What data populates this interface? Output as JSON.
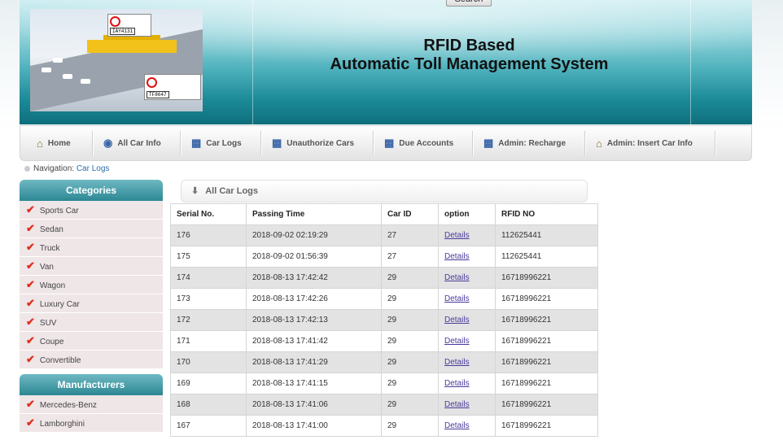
{
  "search": {
    "label": "Search"
  },
  "header": {
    "title_line1": "RFID Based",
    "title_line2": "Automatic Toll Management System"
  },
  "banner": {
    "plate_top": "IAY4131",
    "plate_bottom": "TF8647"
  },
  "nav": [
    {
      "label": "Home",
      "icon": "home-icon"
    },
    {
      "label": "All Car Info",
      "icon": "globe-icon"
    },
    {
      "label": "Car Logs",
      "icon": "car-icon"
    },
    {
      "label": "Unauthorize Cars",
      "icon": "car-icon"
    },
    {
      "label": "Due Accounts",
      "icon": "car-icon"
    },
    {
      "label": "Admin: Recharge",
      "icon": "car-icon"
    },
    {
      "label": "Admin: Insert Car Info",
      "icon": "home-icon"
    }
  ],
  "breadcrumb": {
    "prefix": "Navigation:",
    "link": "Car Logs"
  },
  "categories": {
    "title": "Categories",
    "items": [
      "Sports Car",
      "Sedan",
      "Truck",
      "Van",
      "Wagon",
      "Luxury Car",
      "SUV",
      "Coupe",
      "Convertible"
    ]
  },
  "manufacturers": {
    "title": "Manufacturers",
    "items": [
      "Mercedes-Benz",
      "Lamborghini"
    ]
  },
  "panel": {
    "title": "All Car Logs"
  },
  "table": {
    "headers": [
      "Serial No.",
      "Passing Time",
      "Car ID",
      "option",
      "RFID NO"
    ],
    "rows": [
      [
        "176",
        "2018-09-02 02:19:29",
        "27",
        "Details",
        "112625441"
      ],
      [
        "175",
        "2018-09-02 01:56:39",
        "27",
        "Details",
        "112625441"
      ],
      [
        "174",
        "2018-08-13 17:42:42",
        "29",
        "Details",
        "16718996221"
      ],
      [
        "173",
        "2018-08-13 17:42:26",
        "29",
        "Details",
        "16718996221"
      ],
      [
        "172",
        "2018-08-13 17:42:13",
        "29",
        "Details",
        "16718996221"
      ],
      [
        "171",
        "2018-08-13 17:41:42",
        "29",
        "Details",
        "16718996221"
      ],
      [
        "170",
        "2018-08-13 17:41:29",
        "29",
        "Details",
        "16718996221"
      ],
      [
        "169",
        "2018-08-13 17:41:15",
        "29",
        "Details",
        "16718996221"
      ],
      [
        "168",
        "2018-08-13 17:41:06",
        "29",
        "Details",
        "16718996221"
      ],
      [
        "167",
        "2018-08-13 17:41:00",
        "29",
        "Details",
        "16718996221"
      ]
    ]
  }
}
